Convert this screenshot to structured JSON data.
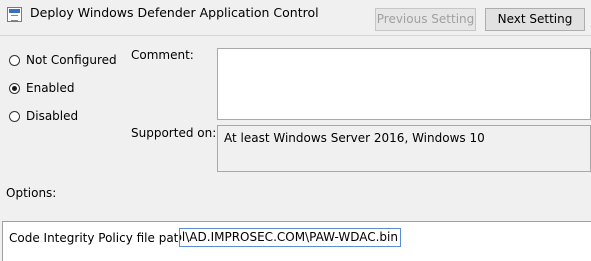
{
  "window": {
    "title": "Deploy Windows Defender Application Control",
    "icon": "policy-setting-icon"
  },
  "navigation": {
    "previous_label": "Previous Setting",
    "next_label": "Next Setting"
  },
  "state": {
    "options": [
      {
        "label": "Not Configured",
        "checked": false
      },
      {
        "label": "Enabled",
        "checked": true
      },
      {
        "label": "Disabled",
        "checked": false
      }
    ]
  },
  "comment": {
    "label": "Comment:",
    "value": ""
  },
  "supported": {
    "label": "Supported on:",
    "value": "At least Windows Server 2016, Windows 10"
  },
  "options_section": {
    "label": "Options:",
    "path_label": "Code Integrity Policy file path:",
    "path_value": "rol\\AD.IMPROSEC.COM\\PAW-WDAC.bin"
  }
}
